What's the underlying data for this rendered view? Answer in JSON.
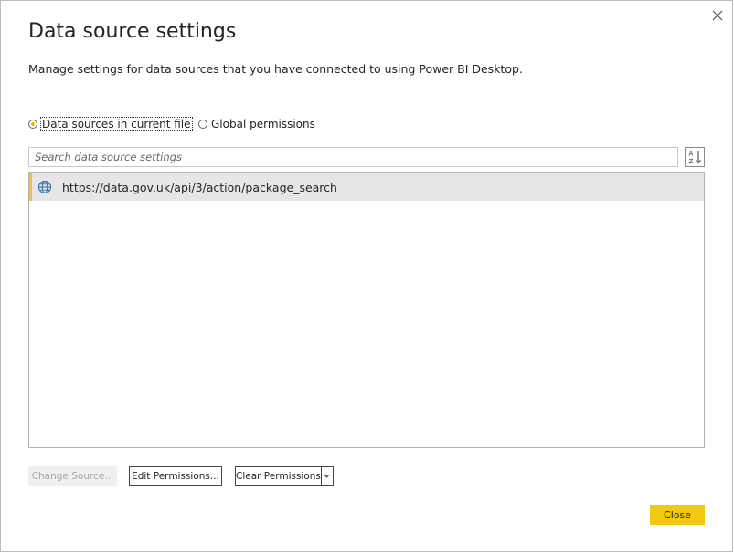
{
  "dialog": {
    "title": "Data source settings",
    "description": "Manage settings for data sources that you have connected to using Power BI Desktop."
  },
  "scope": {
    "options": [
      {
        "label": "Data sources in current file",
        "selected": true
      },
      {
        "label": "Global permissions",
        "selected": false
      }
    ]
  },
  "search": {
    "placeholder": "Search data source settings",
    "value": ""
  },
  "sort": {
    "icon": "sort-az-icon"
  },
  "sources": {
    "items": [
      {
        "icon": "globe-icon",
        "url": "https://data.gov.uk/api/3/action/package_search",
        "selected": true
      }
    ]
  },
  "actions": {
    "change_source": "Change Source...",
    "edit_permissions": "Edit Permissions...",
    "clear_permissions": "Clear Permissions",
    "close": "Close"
  },
  "colors": {
    "accent": "#f2c811",
    "selection_bar": "#e8c24a",
    "selected_row": "#e6e6e6",
    "globe": "#2b6aa8"
  }
}
